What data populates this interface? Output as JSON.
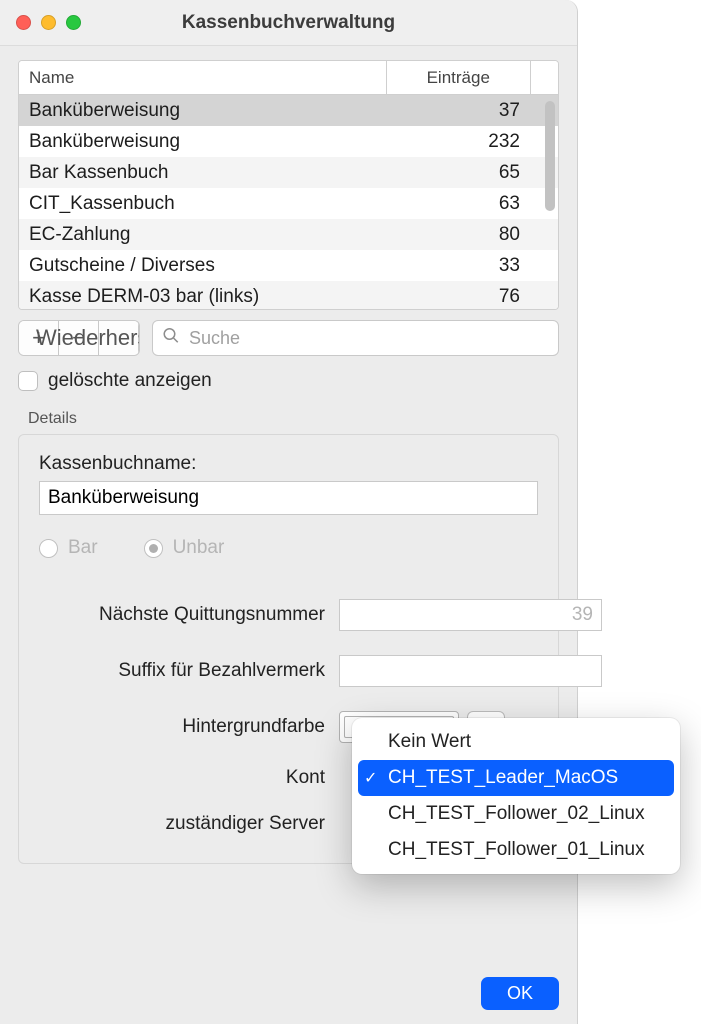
{
  "title": "Kassenbuchverwaltung",
  "table": {
    "header_name": "Name",
    "header_entries": "Einträge",
    "rows": [
      {
        "name": "Banküberweisung",
        "entries": 37,
        "selected": true
      },
      {
        "name": "Banküberweisung",
        "entries": 232
      },
      {
        "name": "Bar Kassenbuch",
        "entries": 65
      },
      {
        "name": "CIT_Kassenbuch",
        "entries": 63
      },
      {
        "name": "EC-Zahlung",
        "entries": 80
      },
      {
        "name": "Gutscheine / Diverses",
        "entries": 33
      },
      {
        "name": "Kasse DERM-03 bar (links)",
        "entries": 76
      }
    ]
  },
  "toolbar": {
    "plus": "+",
    "minus": "−",
    "restore": "Wiederherstellen",
    "search_placeholder": "Suche"
  },
  "show_deleted_label": "gelöschte anzeigen",
  "details": {
    "group_title": "Details",
    "name_label": "Kassenbuchname:",
    "name_value": "Banküberweisung",
    "radio_bar": "Bar",
    "radio_unbar": "Unbar",
    "next_receipt_label": "Nächste Quittungsnummer",
    "next_receipt_value": "39",
    "suffix_label": "Suffix für Bezahlvermerk",
    "suffix_value": "",
    "bgcolor_label": "Hintergrundfarbe",
    "minus_symbol": "−",
    "konto_label": "Kont",
    "server_label": "zuständiger Server"
  },
  "dropdown": {
    "items": [
      {
        "label": "Kein Wert"
      },
      {
        "label": "CH_TEST_Leader_MacOS",
        "selected": true
      },
      {
        "label": "CH_TEST_Follower_02_Linux"
      },
      {
        "label": "CH_TEST_Follower_01_Linux"
      }
    ]
  },
  "ok_label": "OK"
}
